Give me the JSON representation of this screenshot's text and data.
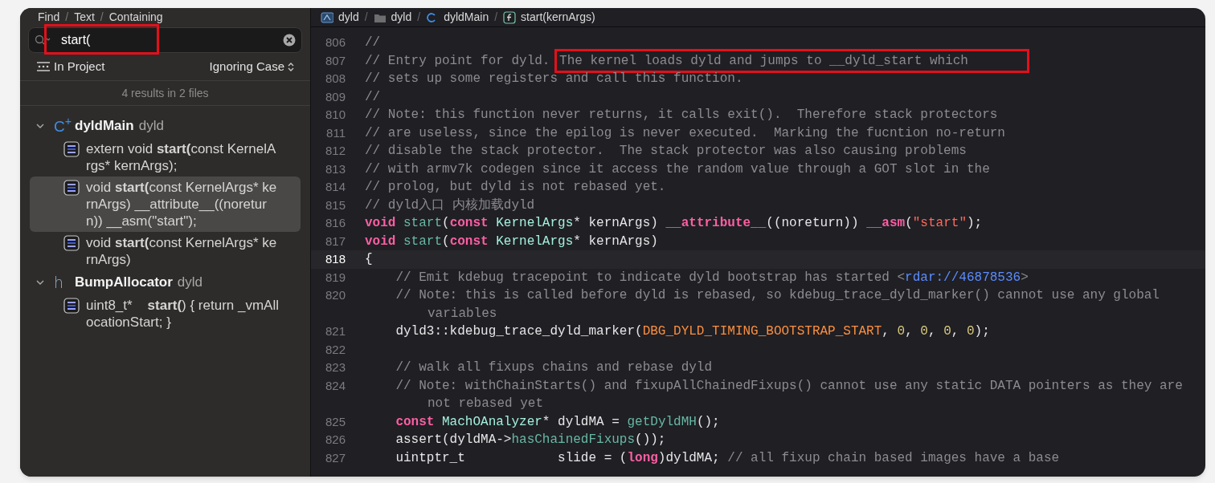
{
  "find_path": [
    {
      "kind": "mode",
      "text": "Find"
    },
    {
      "kind": "separator",
      "text": "/"
    },
    {
      "kind": "mode",
      "text": "Text"
    },
    {
      "kind": "separator",
      "text": "/"
    },
    {
      "kind": "mode",
      "text": "Containing"
    }
  ],
  "search": {
    "value": "start(",
    "annotated": true
  },
  "scope": {
    "label": "In Project",
    "case_mode": "Ignoring Case"
  },
  "summary": "4 results in 2 files",
  "results": [
    {
      "kind": "cpp",
      "icon_text": "C$^{+}$",
      "name": "dyldMain",
      "module": "dyld",
      "expanded": true,
      "children": [
        {
          "text": "extern void **start(**const KernelArgs* kernArgs);",
          "selected": false
        },
        {
          "text": "void **start(**const KernelArgs* kernArgs) __attribute__((noreturn)) __asm(\"start\");",
          "selected": true
        },
        {
          "text": "void **start(**const KernelArgs* kernArgs)",
          "selected": false
        }
      ]
    },
    {
      "kind": "header",
      "icon_text": "h",
      "name": "BumpAllocator",
      "module": "dyld",
      "expanded": true,
      "children": [
        {
          "text": "uint8_t*    **start(**) { return _vmAllocationStart; }",
          "selected": false
        }
      ]
    }
  ],
  "breadcrumbs": [
    {
      "kind": "project",
      "text": "dyld"
    },
    {
      "kind": "separator",
      "text": "/"
    },
    {
      "kind": "folder",
      "text": "dyld"
    },
    {
      "kind": "separator",
      "text": "/"
    },
    {
      "kind": "cpp",
      "text": "dyldMain"
    },
    {
      "kind": "separator",
      "text": "/"
    },
    {
      "kind": "function",
      "text": "start(kernArgs)"
    }
  ],
  "code_lines": [
    {
      "n": "806",
      "current": false,
      "segs": [
        {
          "kind": "comment",
          "text": "//"
        }
      ]
    },
    {
      "n": "807",
      "current": false,
      "segs": [
        {
          "kind": "comment",
          "text": "// Entry point for dyld. "
        },
        {
          "kind": "comment",
          "text": "The kernel loads dyld and jumps to __dyld_start which",
          "annotated": true
        }
      ]
    },
    {
      "n": "808",
      "current": false,
      "segs": [
        {
          "kind": "comment",
          "text": "// sets up some registers and call this function."
        }
      ]
    },
    {
      "n": "809",
      "current": false,
      "segs": [
        {
          "kind": "comment",
          "text": "//"
        }
      ]
    },
    {
      "n": "810",
      "current": false,
      "segs": [
        {
          "kind": "comment",
          "text": "// Note: this function never returns, it calls exit().  Therefore stack protectors"
        }
      ]
    },
    {
      "n": "811",
      "current": false,
      "segs": [
        {
          "kind": "comment",
          "text": "// are useless, since the epilog is never executed.  Marking the fucntion no-return"
        }
      ]
    },
    {
      "n": "812",
      "current": false,
      "segs": [
        {
          "kind": "comment",
          "text": "// disable the stack protector.  The stack protector was also causing problems"
        }
      ]
    },
    {
      "n": "813",
      "current": false,
      "segs": [
        {
          "kind": "comment",
          "text": "// with armv7k codegen since it access the random value through a GOT slot in the"
        }
      ]
    },
    {
      "n": "814",
      "current": false,
      "segs": [
        {
          "kind": "comment",
          "text": "// prolog, but dyld is not rebased yet."
        }
      ]
    },
    {
      "n": "815",
      "current": false,
      "segs": [
        {
          "kind": "comment",
          "text": "// dyld入口 内核加载dyld"
        }
      ]
    },
    {
      "n": "816",
      "current": false,
      "segs": [
        {
          "kind": "keyword",
          "text": "void "
        },
        {
          "kind": "function",
          "text": "start"
        },
        {
          "kind": "plain",
          "text": "("
        },
        {
          "kind": "keyword",
          "text": "const "
        },
        {
          "kind": "type",
          "text": "KernelArgs"
        },
        {
          "kind": "plain",
          "text": "* kernArgs) "
        },
        {
          "kind": "keyword",
          "text": "__attribute__"
        },
        {
          "kind": "plain",
          "text": "((noreturn)) "
        },
        {
          "kind": "keyword",
          "text": "__asm"
        },
        {
          "kind": "plain",
          "text": "("
        },
        {
          "kind": "string",
          "text": "\"start\""
        },
        {
          "kind": "plain",
          "text": ");"
        }
      ]
    },
    {
      "n": "817",
      "current": false,
      "segs": [
        {
          "kind": "keyword",
          "text": "void "
        },
        {
          "kind": "function",
          "text": "start"
        },
        {
          "kind": "plain",
          "text": "("
        },
        {
          "kind": "keyword",
          "text": "const "
        },
        {
          "kind": "type",
          "text": "KernelArgs"
        },
        {
          "kind": "plain",
          "text": "* kernArgs)"
        }
      ]
    },
    {
      "n": "818",
      "current": true,
      "segs": [
        {
          "kind": "plain",
          "text": "{"
        }
      ]
    },
    {
      "n": "819",
      "current": false,
      "segs": [
        {
          "kind": "comment",
          "text": "    // Emit kdebug tracepoint to indicate dyld bootstrap has started <"
        },
        {
          "kind": "link",
          "text": "rdar://46878536"
        },
        {
          "kind": "comment",
          "text": ">"
        }
      ]
    },
    {
      "n": "820",
      "current": false,
      "segs": [
        {
          "kind": "comment",
          "text": "    // Note: this is called before dyld is rebased, so kdebug_trace_dyld_marker() cannot use any global"
        }
      ],
      "wrap": [
        {
          "kind": "comment",
          "text": "variables"
        }
      ]
    },
    {
      "n": "821",
      "current": false,
      "segs": [
        {
          "kind": "plain",
          "text": "    dyld3::kdebug_trace_dyld_marker("
        },
        {
          "kind": "macro",
          "text": "DBG_DYLD_TIMING_BOOTSTRAP_START"
        },
        {
          "kind": "plain",
          "text": ", "
        },
        {
          "kind": "number",
          "text": "0"
        },
        {
          "kind": "plain",
          "text": ", "
        },
        {
          "kind": "number",
          "text": "0"
        },
        {
          "kind": "plain",
          "text": ", "
        },
        {
          "kind": "number",
          "text": "0"
        },
        {
          "kind": "plain",
          "text": ", "
        },
        {
          "kind": "number",
          "text": "0"
        },
        {
          "kind": "plain",
          "text": ");"
        }
      ]
    },
    {
      "n": "822",
      "current": false
    },
    {
      "n": "823",
      "current": false,
      "segs": [
        {
          "kind": "comment",
          "text": "    // walk all fixups chains and rebase dyld"
        }
      ]
    },
    {
      "n": "824",
      "current": false,
      "segs": [
        {
          "kind": "comment",
          "text": "    // Note: withChainStarts() and fixupAllChainedFixups() cannot use any static DATA pointers as they are"
        }
      ],
      "wrap": [
        {
          "kind": "comment",
          "text": "not rebased yet"
        }
      ]
    },
    {
      "n": "825",
      "current": false,
      "segs": [
        {
          "kind": "keyword",
          "text": "    const "
        },
        {
          "kind": "type",
          "text": "MachOAnalyzer"
        },
        {
          "kind": "plain",
          "text": "* dyldMA = "
        },
        {
          "kind": "function",
          "text": "getDyldMH"
        },
        {
          "kind": "plain",
          "text": "();"
        }
      ]
    },
    {
      "n": "826",
      "current": false,
      "segs": [
        {
          "kind": "plain",
          "text": "    assert(dyldMA->"
        },
        {
          "kind": "function",
          "text": "hasChainedFixups"
        },
        {
          "kind": "plain",
          "text": "());"
        }
      ]
    },
    {
      "n": "827",
      "current": false,
      "segs": [
        {
          "kind": "plain",
          "text": "    uintptr_t            slide = ("
        },
        {
          "kind": "keyword",
          "text": "long"
        },
        {
          "kind": "plain",
          "text": ")dyldMA; "
        },
        {
          "kind": "comment",
          "text": "// all fixup chain based images have a base"
        }
      ]
    }
  ]
}
